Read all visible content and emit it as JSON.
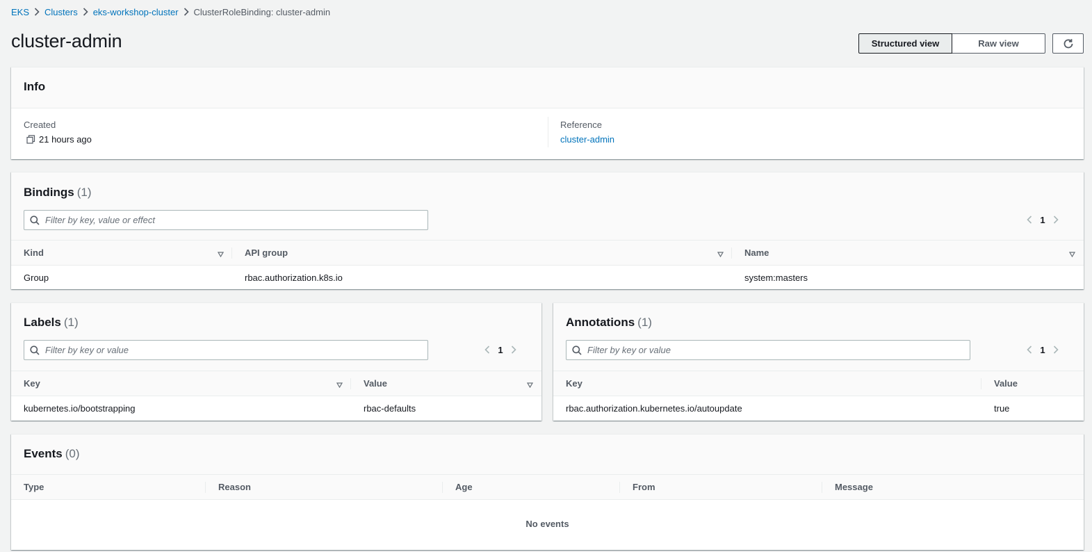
{
  "breadcrumb": {
    "items": [
      {
        "label": "EKS"
      },
      {
        "label": "Clusters"
      },
      {
        "label": "eks-workshop-cluster"
      }
    ],
    "current": "ClusterRoleBinding: cluster-admin"
  },
  "page_title": "cluster-admin",
  "view_toggle": {
    "structured_label": "Structured view",
    "raw_label": "Raw view",
    "active": "structured"
  },
  "info": {
    "title": "Info",
    "created_label": "Created",
    "created_value": "21 hours ago",
    "reference_label": "Reference",
    "reference_value": "cluster-admin"
  },
  "bindings": {
    "title": "Bindings",
    "count": "(1)",
    "search_placeholder": "Filter by key, value or effect",
    "page": "1",
    "columns": [
      "Kind",
      "API group",
      "Name"
    ],
    "rows": [
      [
        "Group",
        "rbac.authorization.k8s.io",
        "system:masters"
      ]
    ]
  },
  "labels": {
    "title": "Labels",
    "count": "(1)",
    "search_placeholder": "Filter by key or value",
    "page": "1",
    "columns": [
      "Key",
      "Value"
    ],
    "rows": [
      [
        "kubernetes.io/bootstrapping",
        "rbac-defaults"
      ]
    ]
  },
  "annotations": {
    "title": "Annotations",
    "count": "(1)",
    "search_placeholder": "Filter by key or value",
    "page": "1",
    "columns": [
      "Key",
      "Value"
    ],
    "rows": [
      [
        "rbac.authorization.kubernetes.io/autoupdate",
        "true"
      ]
    ]
  },
  "events": {
    "title": "Events",
    "count": "(0)",
    "columns": [
      "Type",
      "Reason",
      "Age",
      "From",
      "Message"
    ],
    "empty_text": "No events"
  },
  "colors": {
    "link": "#0073bb",
    "text": "#16191f",
    "muted": "#545b64",
    "background": "#f2f3f3"
  }
}
